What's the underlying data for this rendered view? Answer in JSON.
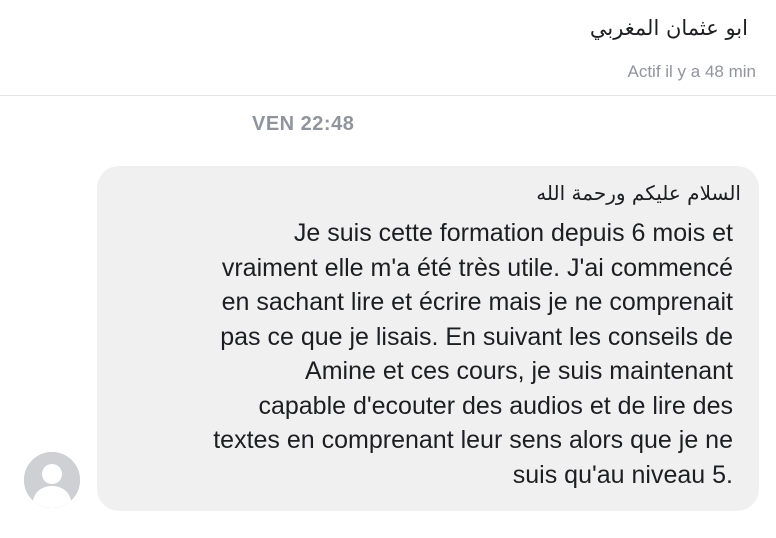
{
  "header": {
    "contact_name": "ابو عثمان المغربي",
    "active_status": "Actif il y a 48 min"
  },
  "conversation": {
    "timestamp": "VEN 22:48"
  },
  "message": {
    "greeting": "السلام عليكم ورحمة الله",
    "lines": [
      "Je suis cette formation depuis 6 mois et",
      "vraiment elle m'a été très utile. J'ai commencé",
      "en sachant lire et écrire mais je ne comprenait",
      "pas ce que je lisais. En suivant les conseils de",
      "Amine et ces cours, je suis maintenant",
      "capable d'ecouter des audios et de lire des",
      "textes en comprenant leur sens alors que je ne",
      ".suis qu'au niveau 5"
    ]
  },
  "avatar": {
    "icon": "default-user-avatar-icon",
    "background_color": "#ced0d4"
  },
  "colors": {
    "bubble_background": "#f1f0f0",
    "muted_text": "#90949c",
    "text": "#1c1e21"
  }
}
